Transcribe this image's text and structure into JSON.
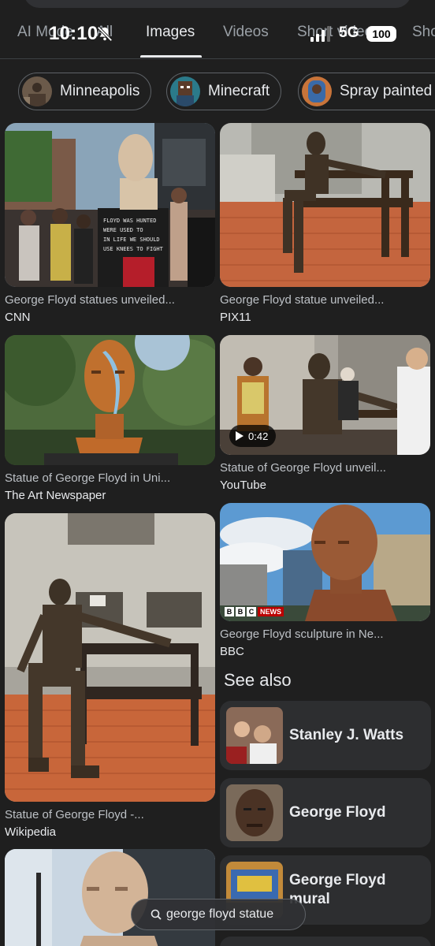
{
  "status_bar": {
    "time": "10:10",
    "network": "5G",
    "battery": "100"
  },
  "tabs": [
    {
      "label": "AI Mode",
      "active": false
    },
    {
      "label": "All",
      "active": false
    },
    {
      "label": "Images",
      "active": true
    },
    {
      "label": "Videos",
      "active": false
    },
    {
      "label": "Short videos",
      "active": false
    },
    {
      "label": "Sho",
      "active": false
    }
  ],
  "chips": [
    {
      "label": "Minneapolis",
      "icon": "minneapolis-thumb"
    },
    {
      "label": "Minecraft",
      "icon": "minecraft-thumb"
    },
    {
      "label": "Spray painted",
      "icon": "spray-painted-thumb"
    }
  ],
  "results": [
    {
      "caption": "George Floyd statues unveiled...",
      "source": "CNN"
    },
    {
      "caption": "George Floyd statue unveiled...",
      "source": "PIX11"
    },
    {
      "caption": "Statue of George Floyd in Uni...",
      "source": "The Art Newspaper"
    },
    {
      "caption": "Statue of George Floyd unveil...",
      "source": "YouTube",
      "video_duration": "0:42"
    },
    {
      "caption": "Statue of George Floyd -...",
      "source": "Wikipedia"
    },
    {
      "caption": "George Floyd sculpture in Ne...",
      "source": "BBC",
      "badge": "BBC NEWS"
    }
  ],
  "see_also": {
    "title": "See also",
    "items": [
      {
        "label": "Stanley J. Watts"
      },
      {
        "label": "George Floyd"
      },
      {
        "label": "George Floyd mural"
      }
    ]
  },
  "query": "george floyd statue",
  "colors": {
    "background": "#1f1f1f",
    "card": "#2d2e30",
    "text": "#e8eaed",
    "muted": "#9aa0a6"
  }
}
